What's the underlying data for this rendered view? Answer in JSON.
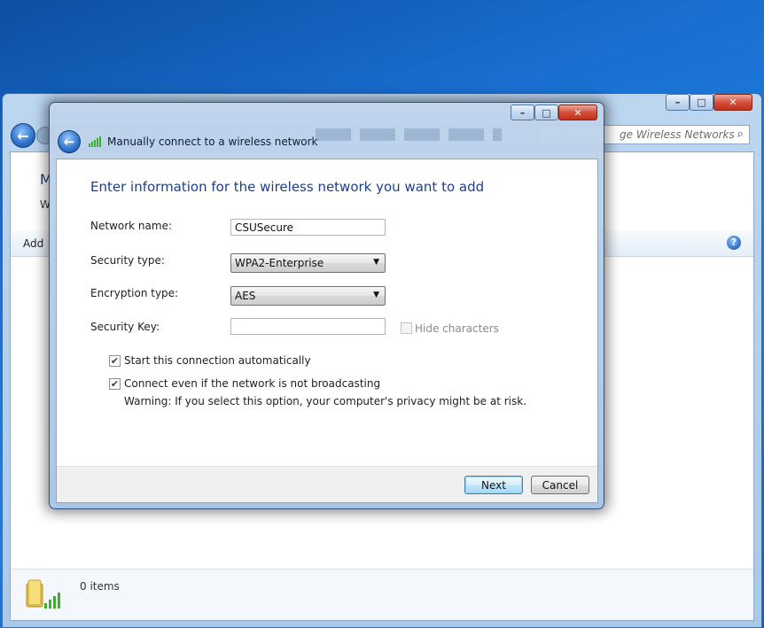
{
  "background_window": {
    "search_placeholder": "Search Manage Wireless Networks",
    "search_visible_text": "ge Wireless Networks",
    "title_fragment": "M",
    "subtitle_fragment": "W",
    "toolbar_add": "Add",
    "status_items": "0 items"
  },
  "dialog": {
    "title": "Manually connect to a wireless network",
    "heading": "Enter information for the wireless network you want to add",
    "network_name_label": "Network name:",
    "network_name_value": "CSUSecure",
    "security_type_label": "Security type:",
    "security_type_value": "WPA2-Enterprise",
    "encryption_type_label": "Encryption type:",
    "encryption_type_value": "AES",
    "security_key_label": "Security Key:",
    "security_key_value": "",
    "hide_characters_label": "Hide characters",
    "hide_characters_checked": false,
    "start_auto_label": "Start this connection automatically",
    "start_auto_checked": true,
    "connect_broadcast_label": "Connect even if the network is not broadcasting",
    "connect_broadcast_checked": true,
    "warning_text": "Warning: If you select this option, your computer's privacy might be at risk.",
    "next_label": "Next",
    "cancel_label": "Cancel"
  },
  "caption": {
    "minimize": "–",
    "maximize": "□",
    "close": "✕"
  },
  "icons": {
    "back": "←",
    "dropdown": "▼",
    "check": "✔",
    "search": "⌕",
    "help": "?"
  },
  "colors": {
    "heading": "#1e3f8c",
    "close_button": "#c2301b",
    "default_button_border": "#3c7fb1"
  }
}
